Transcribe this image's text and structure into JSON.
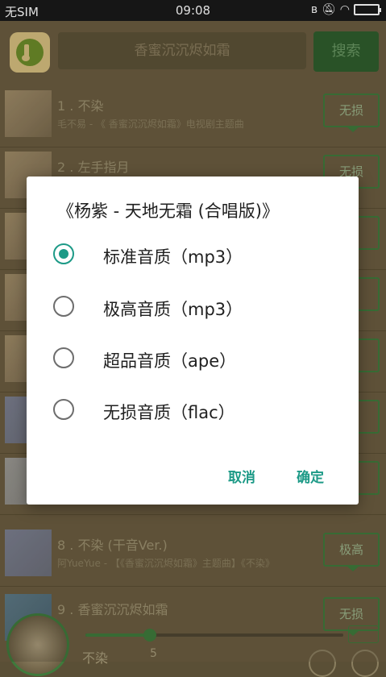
{
  "status_bar": {
    "carrier": "无SIM",
    "time": "09:08",
    "icons": [
      "bluetooth-icon",
      "mute-icon",
      "wifi-icon",
      "battery-icon"
    ]
  },
  "header": {
    "search_value": "香蜜沉沉烬如霜",
    "search_button": "搜索"
  },
  "songs": [
    {
      "title": "1 . 不染",
      "subtitle": "毛不易 - 《 香蜜沉沉烬如霜》电视剧主题曲",
      "quality": "无损"
    },
    {
      "title": "2 . 左手指月",
      "subtitle": "",
      "quality": "无损"
    },
    {
      "title": "",
      "subtitle": "",
      "quality": ""
    },
    {
      "title": "",
      "subtitle": "",
      "quality": ""
    },
    {
      "title": "",
      "subtitle": "",
      "quality": ""
    },
    {
      "title": "",
      "subtitle": "",
      "quality": ""
    },
    {
      "title": "",
      "subtitle": "",
      "quality": ""
    },
    {
      "title": "8 . 不染 (干音Ver.)",
      "subtitle": "阿YueYue - 【《香蜜沉沉烬如霜》主题曲】《不染》",
      "quality": "极高"
    },
    {
      "title": "9 . 香蜜沉沉烬如霜",
      "subtitle": "",
      "quality": "无损"
    }
  ],
  "player": {
    "title": "不染",
    "time": "5",
    "loop_label": "",
    "progress": 0.25
  },
  "dialog": {
    "title": "《杨紫 - 天地无霜 (合唱版)》",
    "options": [
      {
        "label": "标准音质（mp3）",
        "checked": true
      },
      {
        "label": "极高音质（mp3）",
        "checked": false
      },
      {
        "label": "超品音质（ape）",
        "checked": false
      },
      {
        "label": "无损音质（flac）",
        "checked": false
      }
    ],
    "cancel_label": "取消",
    "confirm_label": "确定"
  },
  "colors": {
    "accent": "#1d9a87",
    "status_bar_bg": "#1a1a1a",
    "background_dim": "#6b5d40",
    "quality_green": "#3f7a3c"
  }
}
